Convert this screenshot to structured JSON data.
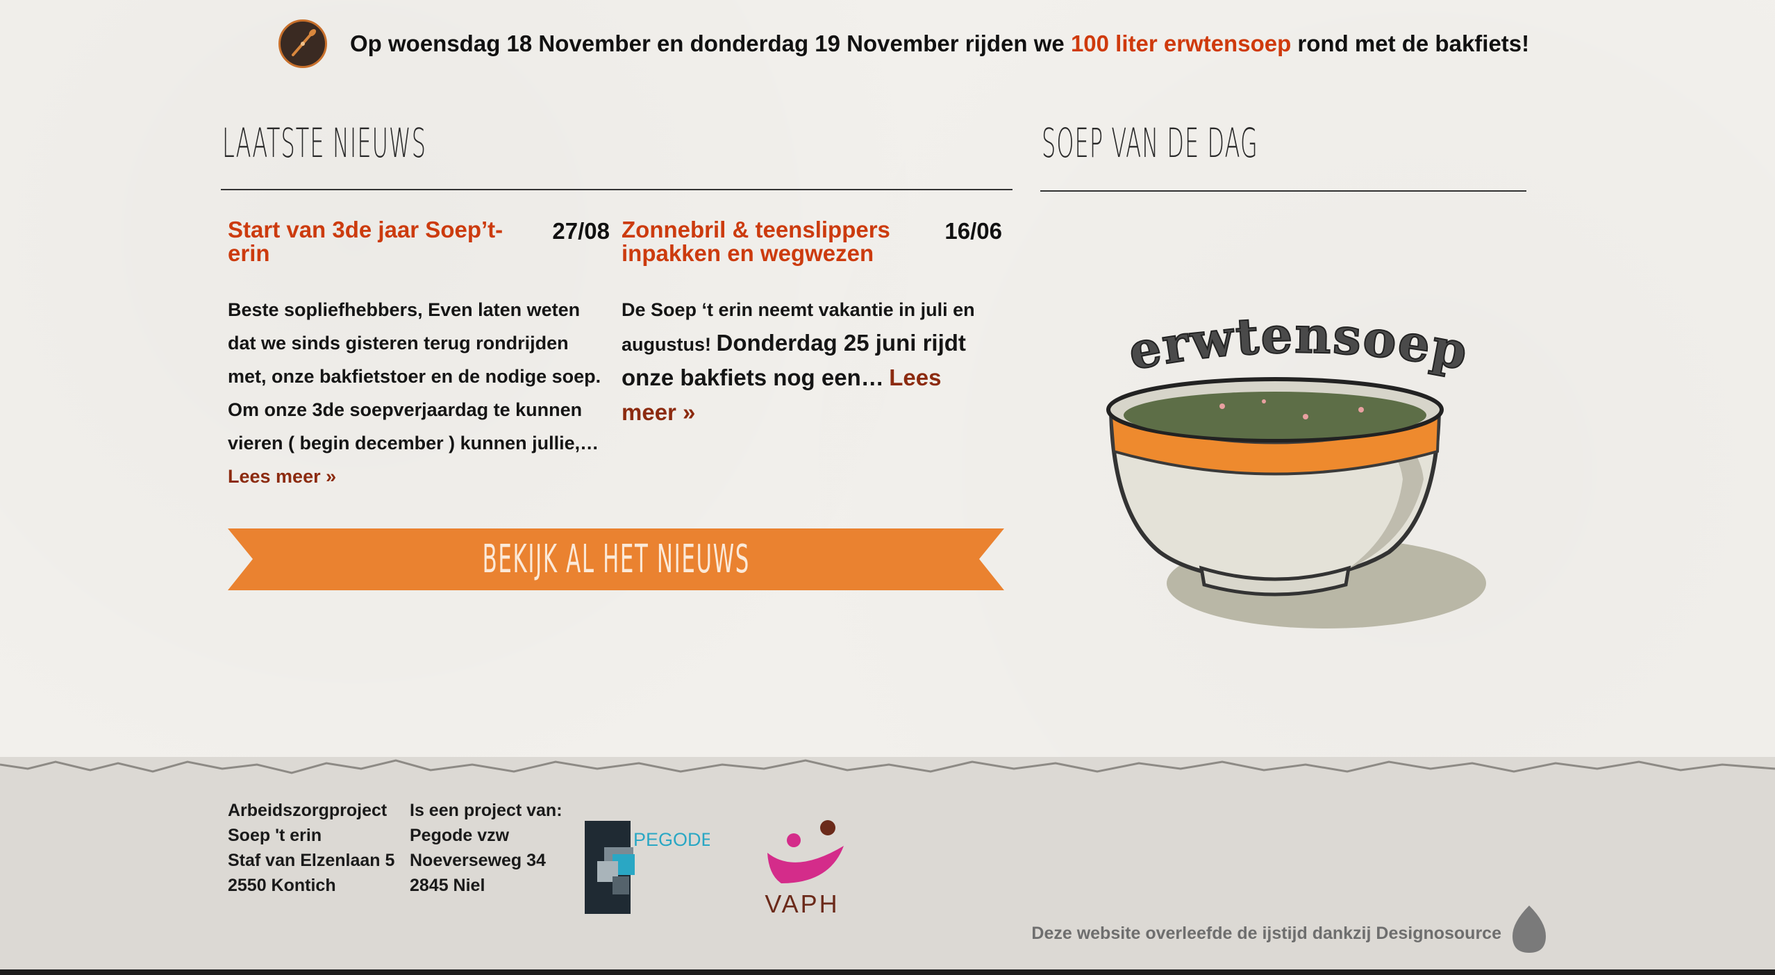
{
  "announcement": {
    "text_before": "Op woensdag 18 November en donderdag 19 November rijden we ",
    "highlight": "100 liter erwtensoep",
    "text_after": " rond met de bakfiets!",
    "icon": "spoon-icon"
  },
  "news_section": {
    "title": "LAATSTE NIEUWS",
    "items": [
      {
        "title": "Start van 3de jaar Soep’t-erin",
        "date": "27/08",
        "excerpt": "Beste sopliefhebbers, Even laten weten dat we sinds gisteren terug rondrijden met, onze bakfietstoer en de nodige soep. Om onze 3de soepverjaardag te kunnen vieren ( begin december ) kunnen jullie,…",
        "read_more": "Lees meer »"
      },
      {
        "title": "Zonnebril & teenslippers inpakken en wegwezen",
        "date": "16/06",
        "excerpt_small": "De Soep ‘t erin neemt vakantie in juli en augustus!",
        "excerpt_large": "Donderdag 25 juni rijdt onze bakfiets nog een…",
        "read_more": "Lees meer »"
      }
    ],
    "all_news_button": "BEKIJK AL HET NIEUWS"
  },
  "soup_section": {
    "title": "SOEP VAN DE DAG",
    "soup_name": "erwtensoep"
  },
  "footer": {
    "address": [
      "Arbeidszorgproject",
      "Soep 't erin",
      "Staf van Elzenlaan 5",
      "2550 Kontich"
    ],
    "project_of": [
      "Is een project van:",
      "Pegode vzw",
      "Noeverseweg 34",
      "2845 Niel"
    ],
    "logo_pegode": "PEGODE",
    "logo_vaph": "VAPH",
    "credit": "Deze website overleefde de ijstijd dankzij Designosource"
  },
  "colors": {
    "accent_red": "#cc3b0e",
    "banner_orange": "#ea8230",
    "read_more": "#8c2b10",
    "footer_bg": "#dcd9d4"
  }
}
